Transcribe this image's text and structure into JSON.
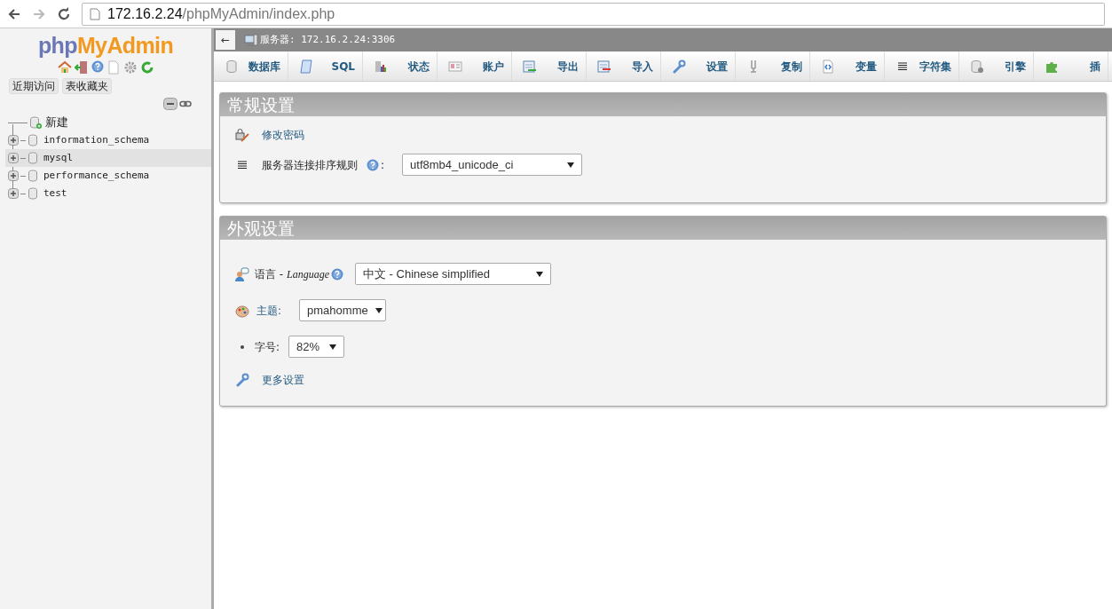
{
  "browser": {
    "url_host": "172.16.2.24",
    "url_path": "/phpMyAdmin/index.php"
  },
  "sidebar": {
    "logo_php": "php",
    "logo_rest": "MyAdmin",
    "links": [
      "近期访问",
      "表收藏夹"
    ],
    "tree": [
      {
        "label": "新建",
        "kind": "new",
        "selected": false
      },
      {
        "label": "information_schema",
        "kind": "db",
        "selected": false
      },
      {
        "label": "mysql",
        "kind": "db",
        "selected": true
      },
      {
        "label": "performance_schema",
        "kind": "db",
        "selected": false
      },
      {
        "label": "test",
        "kind": "db",
        "selected": false
      }
    ]
  },
  "breadcrumb": {
    "back": "←",
    "server": "服务器: 172.16.2.24:3306"
  },
  "tabs": [
    {
      "label": "数据库",
      "kind": "database"
    },
    {
      "label": "SQL",
      "kind": "sql"
    },
    {
      "label": "状态",
      "kind": "status"
    },
    {
      "label": "账户",
      "kind": "accounts"
    },
    {
      "label": "导出",
      "kind": "export"
    },
    {
      "label": "导入",
      "kind": "import"
    },
    {
      "label": "设置",
      "kind": "settings"
    },
    {
      "label": "复制",
      "kind": "replication"
    },
    {
      "label": "变量",
      "kind": "variables"
    },
    {
      "label": "字符集",
      "kind": "charset"
    },
    {
      "label": "引擎",
      "kind": "engines"
    },
    {
      "label": "插",
      "kind": "plugins"
    }
  ],
  "general": {
    "title": "常规设置",
    "change_password": "修改密码",
    "collation_label": "服务器连接排序规则",
    "collation_colon": ":",
    "collation_value": "utf8mb4_unicode_ci"
  },
  "appearance": {
    "title": "外观设置",
    "language_label": "语言 - ",
    "language_word": "Language",
    "language_value": "中文 - Chinese simplified",
    "theme_label": "主题:",
    "theme_value": "pmahomme",
    "font_label": "字号:",
    "font_value": "82%",
    "more": "更多设置"
  }
}
